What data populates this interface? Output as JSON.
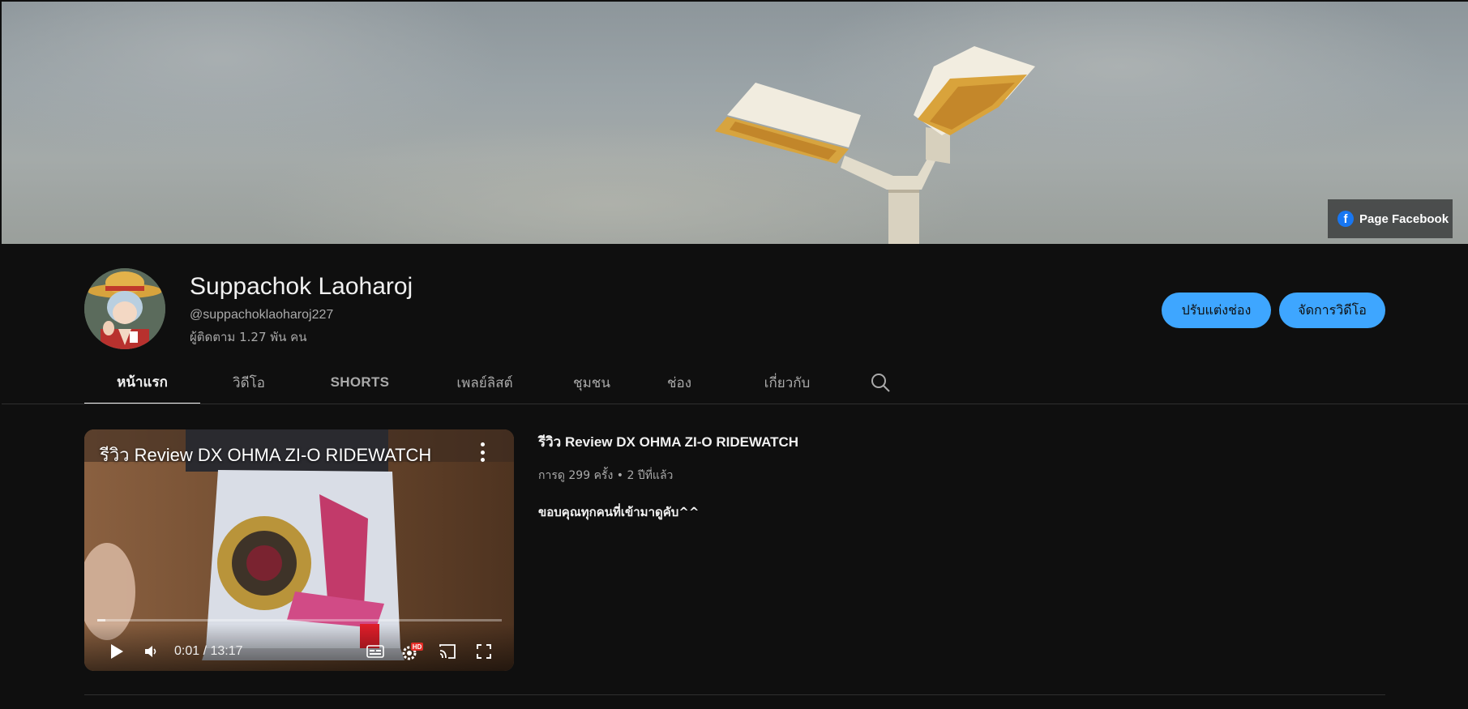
{
  "banner": {
    "link_label": "Page Facebook",
    "link_icon": "facebook-icon"
  },
  "channel": {
    "name": "Suppachok Laoharoj",
    "handle": "@suppachoklaoharoj227",
    "subscribers": "ผู้ติดตาม 1.27 พัน คน"
  },
  "actions": {
    "customize_label": "ปรับแต่งช่อง",
    "manage_label": "จัดการวิดีโอ"
  },
  "tabs": [
    {
      "label": "หน้าแรก",
      "active": true
    },
    {
      "label": "วิดีโอ"
    },
    {
      "label": "SHORTS"
    },
    {
      "label": "เพลย์ลิสต์"
    },
    {
      "label": "ชุมชน"
    },
    {
      "label": "ช่อง"
    },
    {
      "label": "เกี่ยวกับ"
    }
  ],
  "featured_video": {
    "player_title": "รีวิว Review DX OHMA ZI-O RIDEWATCH",
    "time_display": "0:01 / 13:17",
    "progress": 0.0013,
    "quality_badge": "HD",
    "title": "รีวิว Review DX OHMA ZI-O RIDEWATCH",
    "meta": "การดู 299 ครั้ง • 2 ปีที่แล้ว",
    "description": "ขอบคุณทุกคนที่เข้ามาดูคับ^^"
  },
  "colors": {
    "background": "#0f0f0f",
    "accent": "#3ea6ff",
    "facebook": "#1877f2"
  }
}
